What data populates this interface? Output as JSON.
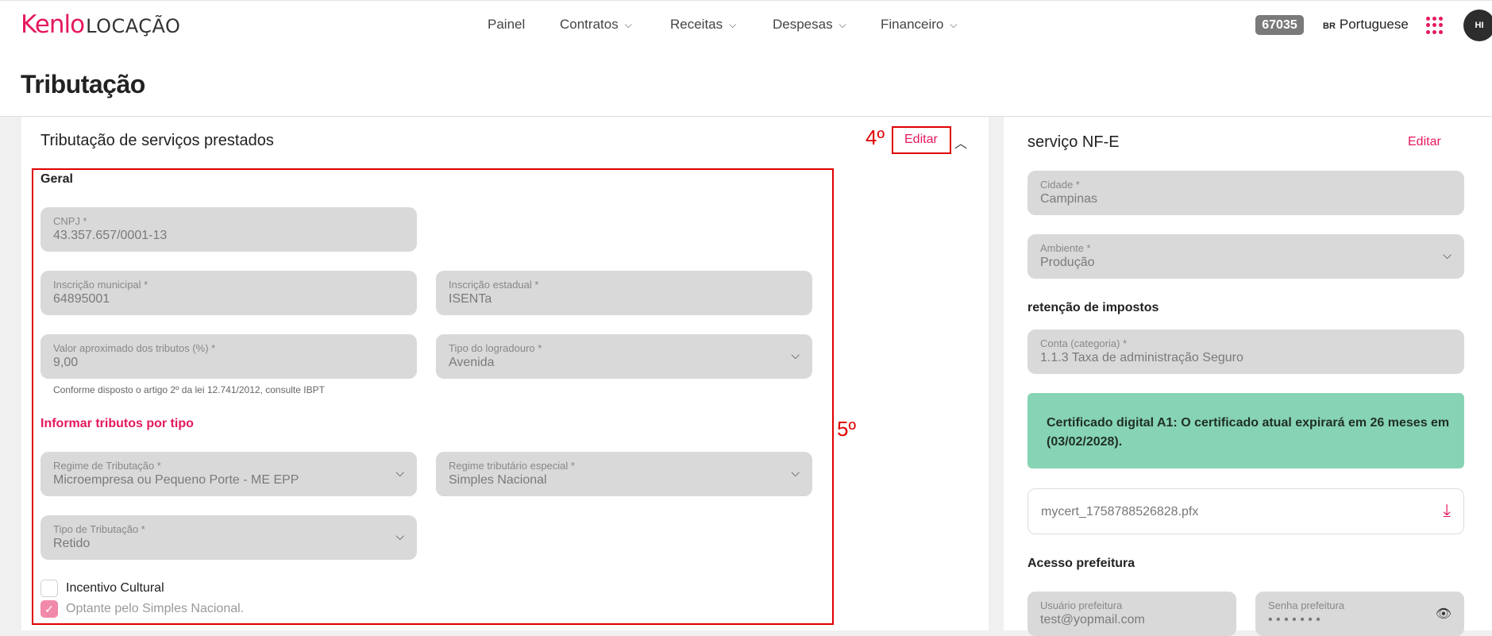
{
  "app": {
    "logo_brand": "Kenlo",
    "logo_sub": "LOCAÇÃO",
    "nav": [
      {
        "label": "Painel",
        "dropdown": false
      },
      {
        "label": "Contratos",
        "dropdown": true
      },
      {
        "label": "Receitas",
        "dropdown": true
      },
      {
        "label": "Despesas",
        "dropdown": true
      },
      {
        "label": "Financeiro",
        "dropdown": true
      }
    ],
    "account_number": "67035",
    "lang_flag": "BR",
    "language": "Portuguese",
    "avatar_initials": "HI",
    "accent_color": "#e5195c"
  },
  "page": {
    "title": "Tributação"
  },
  "left": {
    "title": "Tributação de serviços prestados",
    "edit_label": "Editar",
    "geral": "Geral",
    "cnpj": {
      "label": "CNPJ *",
      "value": "43.357.657/0001-13"
    },
    "insc_municipal": {
      "label": "Inscrição municipal *",
      "value": "64895001"
    },
    "insc_estadual": {
      "label": "Inscrição estadual *",
      "value": "ISENTa"
    },
    "valor_tributos": {
      "label": "Valor aproximado dos tributos (%) *",
      "value": "9,00"
    },
    "tipo_logradouro": {
      "label": "Tipo do logradouro *",
      "value": "Avenida"
    },
    "hint": "Conforme disposto o artigo 2º da lei 12.741/2012, consulte IBPT",
    "informar_tributos": "Informar tributos por tipo",
    "regime_tributacao": {
      "label": "Regime de Tributação *",
      "value": "Microempresa ou Pequeno Porte - ME EPP"
    },
    "regime_especial": {
      "label": "Regime tributário especial *",
      "value": "Simples Nacional"
    },
    "tipo_tributacao": {
      "label": "Tipo de Tributação *",
      "value": "Retido"
    },
    "incentivo_cultural": {
      "label": "Incentivo Cultural",
      "checked": false
    },
    "optante_simples": {
      "label": "Optante pelo Simples Nacional.",
      "checked": true
    }
  },
  "annotations": {
    "step4": "4º",
    "step5": "5º",
    "color": "#e00000"
  },
  "right": {
    "title": "serviço NF-E",
    "edit_label": "Editar",
    "cidade": {
      "label": "Cidade *",
      "value": "Campinas"
    },
    "ambiente": {
      "label": "Ambiente *",
      "value": "Produção"
    },
    "retencao": "retenção de impostos",
    "conta": {
      "label": "Conta (categoria) *",
      "value": "1.1.3 Taxa de administração Seguro"
    },
    "cert_message": "Certificado digital A1: O certificado atual expirará em 26 meses em (03/02/2028).",
    "cert_color": "#87d4b4",
    "cert_file": "mycert_1758788526828.pfx",
    "acesso": "Acesso prefeitura",
    "usuario": {
      "label": "Usuário prefeitura",
      "value": "test@yopmail.com"
    },
    "senha": {
      "label": "Senha prefeitura",
      "value": "• • • • • • •"
    }
  }
}
